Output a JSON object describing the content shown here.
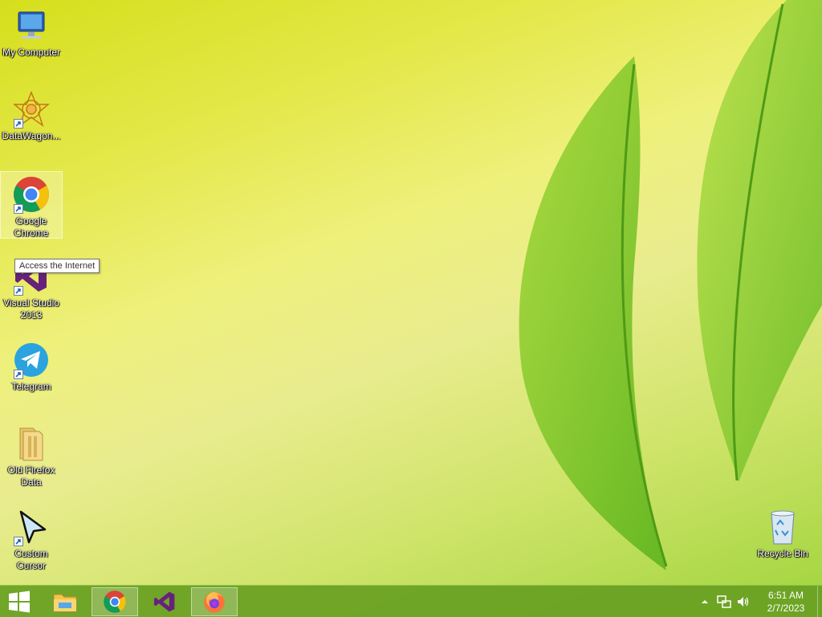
{
  "desktop": {
    "icons": [
      {
        "label": "My Computer"
      },
      {
        "label": "DataWagon..."
      },
      {
        "label": "Google Chrome"
      },
      {
        "label": "Visual Studio 2013"
      },
      {
        "label": "Telegram"
      },
      {
        "label": "Old Firefox Data"
      },
      {
        "label": "Custom Cursor"
      }
    ],
    "recycle_bin": {
      "label": "Recycle Bin"
    },
    "tooltip": "Access the Internet"
  },
  "taskbar": {
    "items": [
      "start-button",
      "file-explorer",
      "google-chrome",
      "visual-studio",
      "firefox"
    ],
    "clock": {
      "time": "6:51 AM",
      "date": "2/7/2023"
    }
  },
  "colors": {
    "taskbar": "#68a022",
    "selection": "#ffffff"
  }
}
